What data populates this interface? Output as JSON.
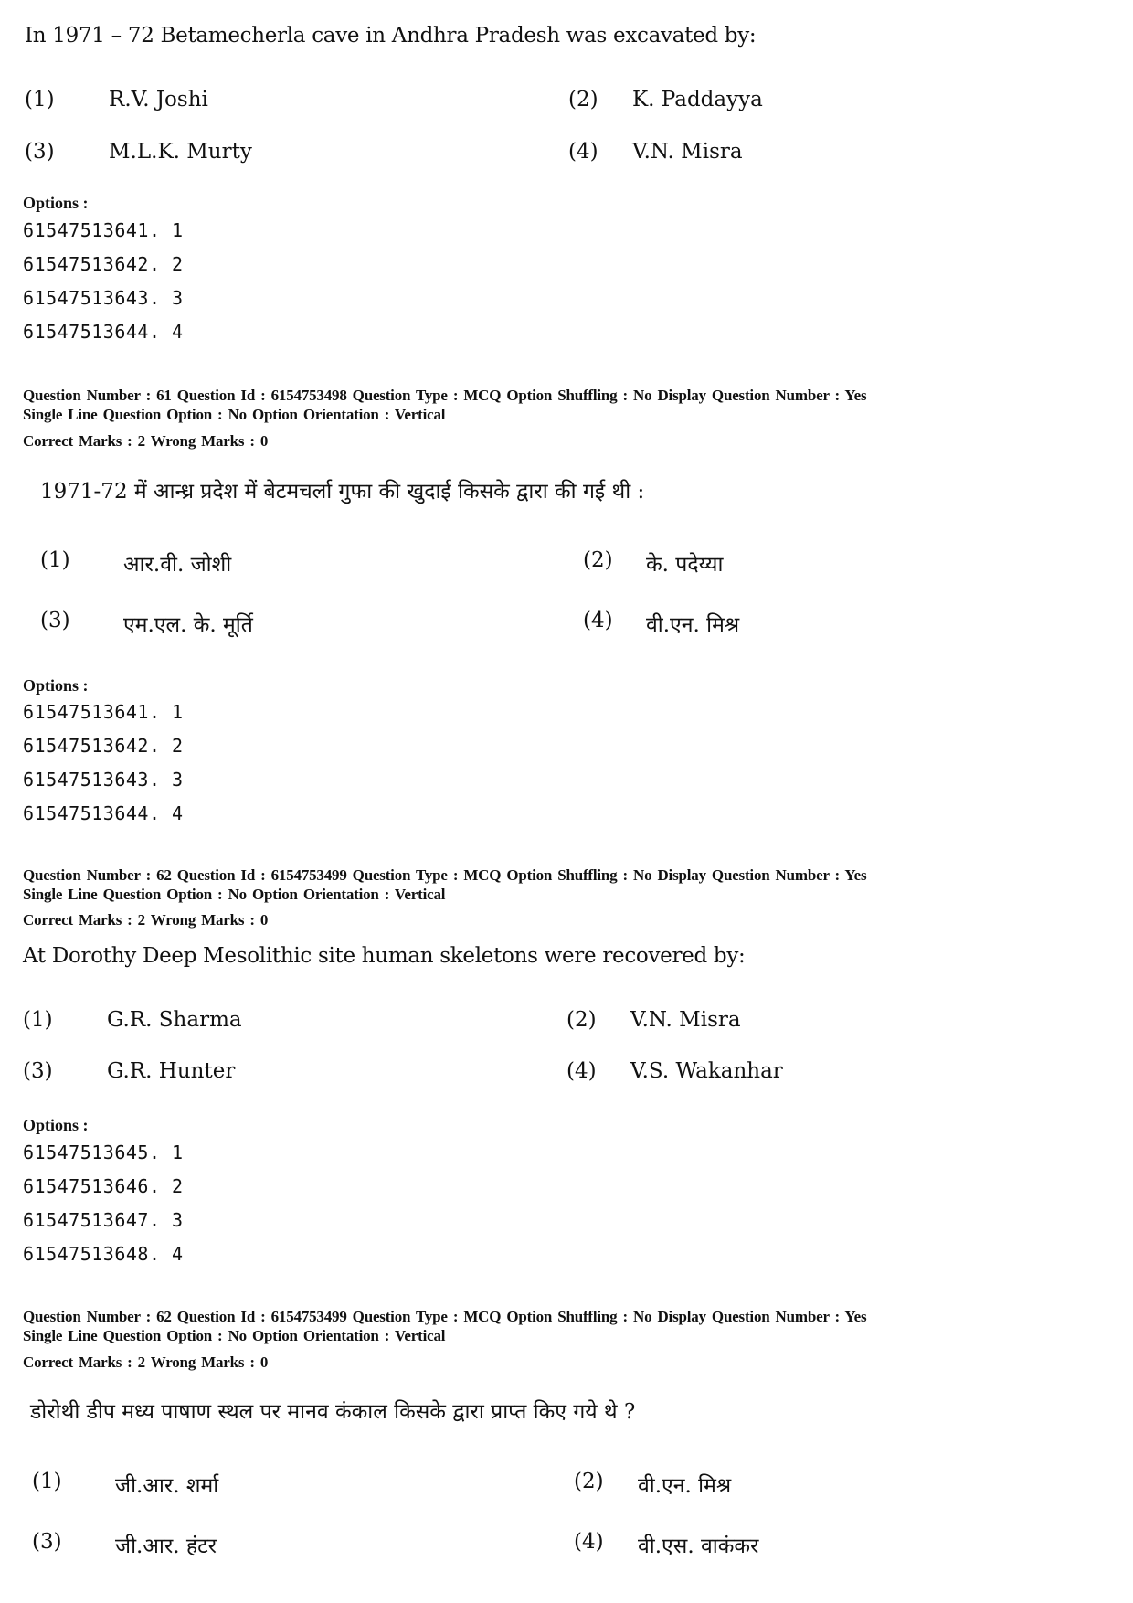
{
  "blocks": [
    {
      "question": "In 1971 – 72 Betamecherla cave in Andhra Pradesh was excavated by:",
      "answers": [
        {
          "num": "(1)",
          "text": "R.V. Joshi"
        },
        {
          "num": "(2)",
          "text": "K. Paddayya"
        },
        {
          "num": "(3)",
          "text": "M.L.K. Murty"
        },
        {
          "num": "(4)",
          "text": "V.N. Misra"
        }
      ],
      "options_label": "Options :",
      "options": [
        "61547513641. 1",
        "61547513642. 2",
        "61547513643. 3",
        "61547513644. 4"
      ]
    },
    {
      "meta_line1": "Question Number : 61  Question Id : 6154753498  Question Type : MCQ  Option Shuffling : No  Display Question Number : Yes",
      "meta_line2": "Single Line Question Option : No  Option Orientation : Vertical",
      "marks": "Correct Marks : 2  Wrong Marks : 0",
      "question": "1971-72 में आन्ध्र प्रदेश में बेटमचर्ला गुफा की खुदाई किसके द्वारा की गई थी :",
      "answers": [
        {
          "num": "(1)",
          "text": "आर.वी. जोशी"
        },
        {
          "num": "(2)",
          "text": "के. पदेय्या"
        },
        {
          "num": "(3)",
          "text": "एम.एल. के. मूर्ति"
        },
        {
          "num": "(4)",
          "text": "वी.एन. मिश्र"
        }
      ],
      "options_label": "Options :",
      "options": [
        "61547513641. 1",
        "61547513642. 2",
        "61547513643. 3",
        "61547513644. 4"
      ]
    },
    {
      "meta_line1": "Question Number : 62  Question Id : 6154753499  Question Type : MCQ  Option Shuffling : No  Display Question Number : Yes",
      "meta_line2": "Single Line Question Option : No  Option Orientation : Vertical",
      "marks": "Correct Marks : 2  Wrong Marks : 0",
      "question": "At Dorothy Deep Mesolithic site human skeletons were recovered by:",
      "answers": [
        {
          "num": "(1)",
          "text": "G.R. Sharma"
        },
        {
          "num": "(2)",
          "text": "V.N. Misra"
        },
        {
          "num": "(3)",
          "text": "G.R. Hunter"
        },
        {
          "num": "(4)",
          "text": "V.S. Wakanhar"
        }
      ],
      "options_label": "Options :",
      "options": [
        "61547513645. 1",
        "61547513646. 2",
        "61547513647. 3",
        "61547513648. 4"
      ]
    },
    {
      "meta_line1": "Question Number : 62  Question Id : 6154753499  Question Type : MCQ  Option Shuffling : No  Display Question Number : Yes",
      "meta_line2": "Single Line Question Option : No  Option Orientation : Vertical",
      "marks": "Correct Marks : 2  Wrong Marks : 0",
      "question": "डोरोथी डीप मध्य पाषाण स्थल पर मानव कंकाल किसके द्वारा प्राप्त किए गये थे ?",
      "answers": [
        {
          "num": "(1)",
          "text": "जी.आर. शर्मा"
        },
        {
          "num": "(2)",
          "text": "वी.एन. मिश्र"
        },
        {
          "num": "(3)",
          "text": "जी.आर. हंटर"
        },
        {
          "num": "(4)",
          "text": "वी.एस. वाकंकर"
        }
      ]
    }
  ]
}
